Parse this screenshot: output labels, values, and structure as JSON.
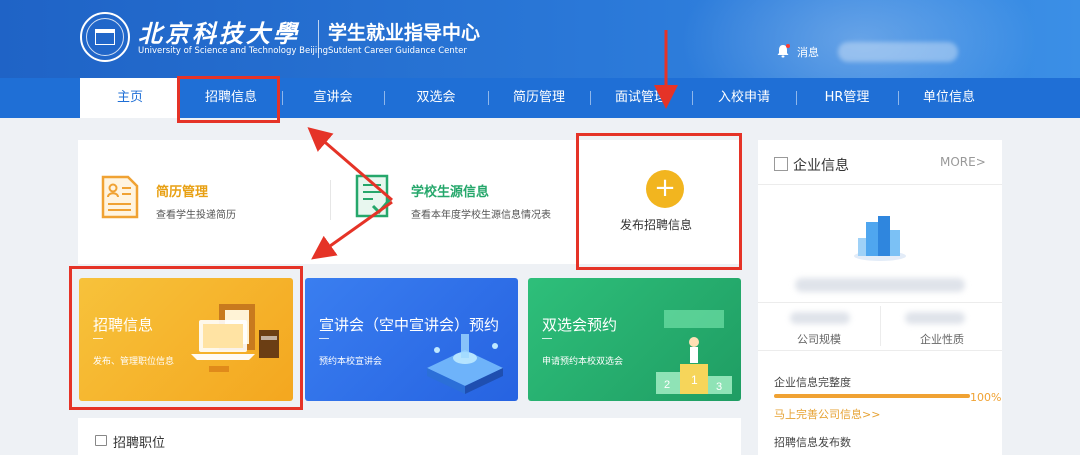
{
  "header": {
    "university_cn": "北京科技大學",
    "university_en": "University of Science and Technology Beijing",
    "center_cn": "学生就业指导中心",
    "center_en": "Sutdent Career Guidance Center",
    "messages_label": "消息"
  },
  "nav": {
    "items": [
      {
        "label": "主页",
        "active": true
      },
      {
        "label": "招聘信息"
      },
      {
        "label": "宣讲会"
      },
      {
        "label": "双选会"
      },
      {
        "label": "简历管理"
      },
      {
        "label": "面试管理"
      },
      {
        "label": "入校申请"
      },
      {
        "label": "HR管理"
      },
      {
        "label": "单位信息"
      }
    ]
  },
  "quick": {
    "resume_title": "简历管理",
    "resume_desc": "查看学生投递简历",
    "source_title": "学校生源信息",
    "source_desc": "查看本年度学校生源信息情况表",
    "publish_icon": "+",
    "publish_label": "发布招聘信息"
  },
  "cards": [
    {
      "title": "招聘信息",
      "subtitle": "发布、管理职位信息",
      "color": "#f4a71f"
    },
    {
      "title": "宣讲会（空中宣讲会）预约",
      "subtitle": "预约本校宣讲会",
      "color": "#2663e1"
    },
    {
      "title": "双选会预约",
      "subtitle": "申请预约本校双选会",
      "color": "#1f9d63"
    }
  ],
  "jobs_section": {
    "title": "招聘职位"
  },
  "sidebar": {
    "title": "企业信息",
    "more": "MORE>",
    "scale_label": "公司规模",
    "nature_label": "企业性质",
    "completeness_label": "企业信息完整度",
    "completeness_value": "100%",
    "completeness_fraction": 1.0,
    "improve_link": "马上完善公司信息>>",
    "publish_count_label": "招聘信息发布数"
  },
  "colors": {
    "brand": "#1f6fd6",
    "annotation": "#e53327",
    "accent": "#f2b51f"
  }
}
